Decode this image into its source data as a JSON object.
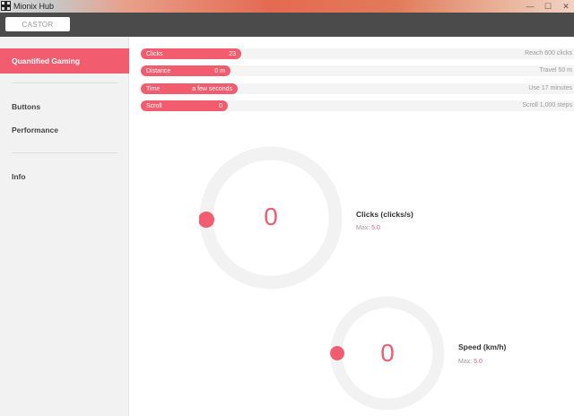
{
  "window": {
    "title": "Mionix Hub",
    "controls": {
      "minimize": "—",
      "maximize": "☐",
      "close": "✕"
    }
  },
  "header": {
    "profile_button": "CASTOR"
  },
  "sidebar": {
    "active_item": "Quantified Gaming",
    "items": [
      "Buttons",
      "Performance",
      "Info"
    ]
  },
  "stats": [
    {
      "name": "Clicks",
      "value": "23",
      "goal": "Reach 600 clicks",
      "progress": 0.038
    },
    {
      "name": "Distance",
      "value": "0 m",
      "goal": "Travel 50 m",
      "progress": 0.0
    },
    {
      "name": "Time",
      "value": "a few seconds",
      "goal": "Use 17 minutes",
      "progress": 0.0
    },
    {
      "name": "Scroll",
      "value": "0",
      "goal": "Scroll 1,000 steps",
      "progress": 0.0
    }
  ],
  "gauges": [
    {
      "value": "0",
      "label": "Clicks (clicks/s)",
      "max_label": "Max:",
      "max_value": "5.0",
      "level": 0
    },
    {
      "value": "0",
      "label": "Speed (km/h)",
      "max_label": "Max:",
      "max_value": "5.0",
      "level": 0
    }
  ],
  "colors": {
    "accent": "#f25c6f",
    "header": "#4b4b4b",
    "sidebar": "#f2f2f2",
    "ring": "#f2f2f2"
  }
}
